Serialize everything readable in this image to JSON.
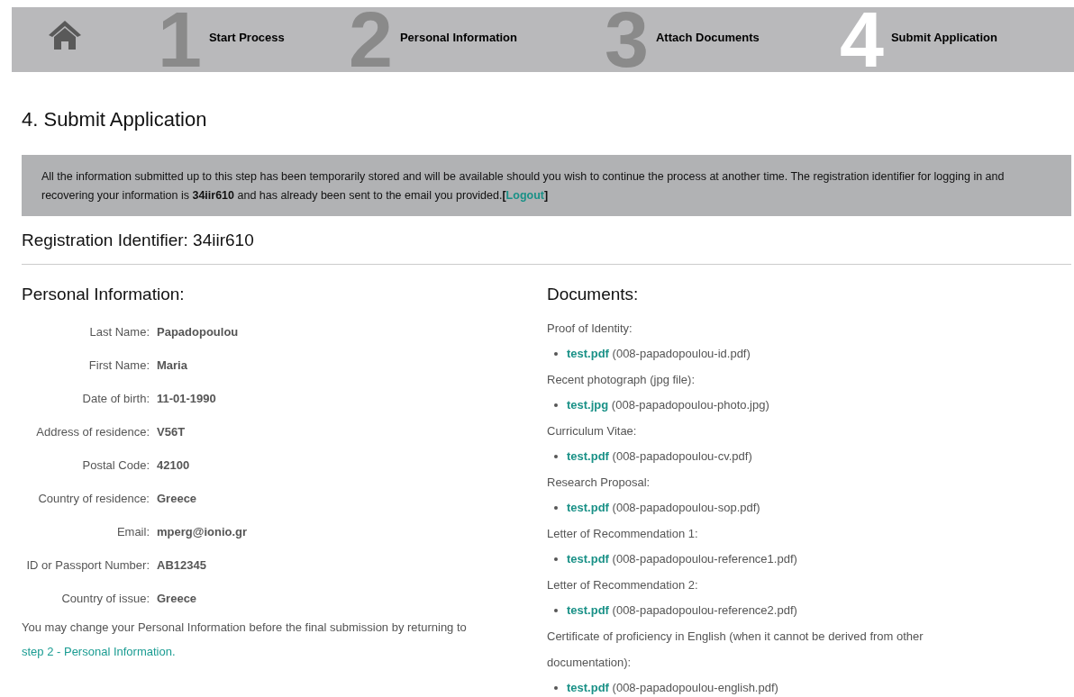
{
  "steps": [
    {
      "number": "1",
      "label": "Start Process",
      "selected": false
    },
    {
      "number": "2",
      "label": "Personal Information",
      "selected": false
    },
    {
      "number": "3",
      "label": "Attach Documents",
      "selected": false
    },
    {
      "number": "4",
      "label": "Submit Application",
      "selected": true
    }
  ],
  "page_title": "4. Submit Application",
  "notice": {
    "text": "All the information submitted up to this step has been temporarily stored and will be available should you wish to continue the process at another time. The registration identifier for logging in and recovering your information is **34iir610** and has already been sent to the email you provided.",
    "link_open": "[",
    "link": "Logout",
    "link_close": "]"
  },
  "registration": "Registration Identifier: 34iir610",
  "personal": {
    "title": "Personal Information:",
    "fields": [
      {
        "label": "Last Name:",
        "value": "Papadopoulou"
      },
      {
        "label": "First Name:",
        "value": "Maria"
      },
      {
        "label": "Date of birth:",
        "value": "11-01-1990"
      },
      {
        "label": "Address of residence:",
        "value": "V56T"
      },
      {
        "label": "Postal Code:",
        "value": "42100"
      },
      {
        "label": "Country of residence:",
        "value": "Greece"
      },
      {
        "label": "Email:",
        "value": "mperg@ionio.gr"
      },
      {
        "label": "ID or Passport Number:",
        "value": "AB12345"
      },
      {
        "label": "Country of issue:",
        "value": "Greece"
      }
    ],
    "note": "You may change your Personal Information before the final submission by returning to",
    "note_link": "step 2 - Personal Information."
  },
  "documents": {
    "title": "Documents:",
    "groups": [
      {
        "label": "Proof of Identity:",
        "file": "test.pdf",
        "stored": "(008-papadopoulou-id.pdf)"
      },
      {
        "label": "Recent photograph (jpg file):",
        "file": "test.jpg",
        "stored": "(008-papadopoulou-photo.jpg)"
      },
      {
        "label": "Curriculum Vitae:",
        "file": "test.pdf",
        "stored": "(008-papadopoulou-cv.pdf)"
      },
      {
        "label": "Research Proposal:",
        "file": "test.pdf",
        "stored": "(008-papadopoulou-sop.pdf)"
      },
      {
        "label": "Letter of Recommendation 1:",
        "file": "test.pdf",
        "stored": "(008-papadopoulou-reference1.pdf)"
      },
      {
        "label": "Letter of Recommendation 2:",
        "file": "test.pdf",
        "stored": "(008-papadopoulou-reference2.pdf)"
      },
      {
        "label": "Certificate of proficiency in English (when it cannot be derived from other documentation):",
        "file": "test.pdf",
        "stored": "(008-papadopoulou-english.pdf)"
      }
    ]
  }
}
